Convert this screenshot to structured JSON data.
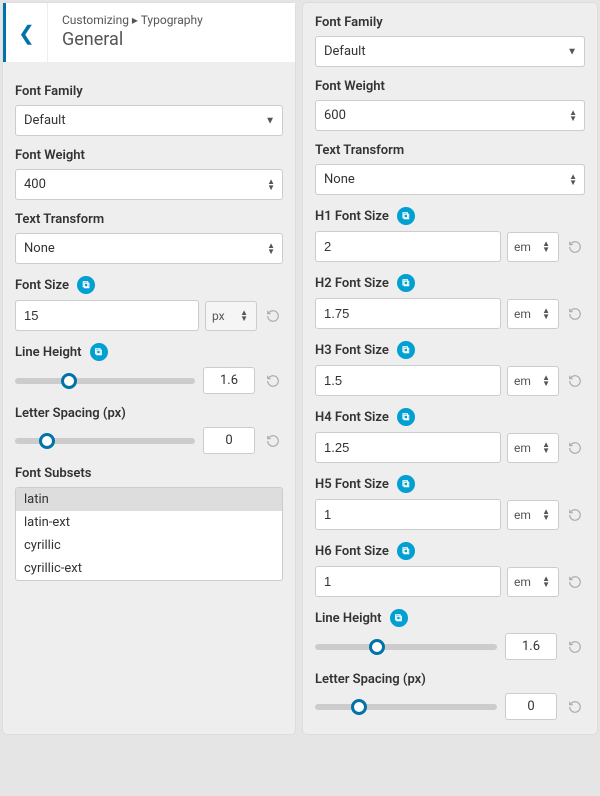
{
  "left": {
    "breadcrumb": "Customizing ▸ Typography",
    "title": "General",
    "font_family": {
      "label": "Font Family",
      "value": "Default"
    },
    "font_weight": {
      "label": "Font Weight",
      "value": "400"
    },
    "text_transform": {
      "label": "Text Transform",
      "value": "None"
    },
    "font_size": {
      "label": "Font Size",
      "value": "15",
      "unit": "px"
    },
    "line_height": {
      "label": "Line Height",
      "value": "1.6",
      "thumb_pct": 30
    },
    "letter_spacing": {
      "label": "Letter Spacing (px)",
      "value": "0",
      "thumb_pct": 18
    },
    "font_subsets": {
      "label": "Font Subsets",
      "options": [
        "latin",
        "latin-ext",
        "cyrillic",
        "cyrillic-ext"
      ],
      "selected": "latin"
    }
  },
  "right": {
    "font_family": {
      "label": "Font Family",
      "value": "Default"
    },
    "font_weight": {
      "label": "Font Weight",
      "value": "600"
    },
    "text_transform": {
      "label": "Text Transform",
      "value": "None"
    },
    "headings": [
      {
        "label": "H1 Font Size",
        "value": "2",
        "unit": "em"
      },
      {
        "label": "H2 Font Size",
        "value": "1.75",
        "unit": "em"
      },
      {
        "label": "H3 Font Size",
        "value": "1.5",
        "unit": "em"
      },
      {
        "label": "H4 Font Size",
        "value": "1.25",
        "unit": "em"
      },
      {
        "label": "H5 Font Size",
        "value": "1",
        "unit": "em"
      },
      {
        "label": "H6 Font Size",
        "value": "1",
        "unit": "em"
      }
    ],
    "line_height": {
      "label": "Line Height",
      "value": "1.6",
      "thumb_pct": 34
    },
    "letter_spacing": {
      "label": "Letter Spacing (px)",
      "value": "0",
      "thumb_pct": 24
    }
  }
}
